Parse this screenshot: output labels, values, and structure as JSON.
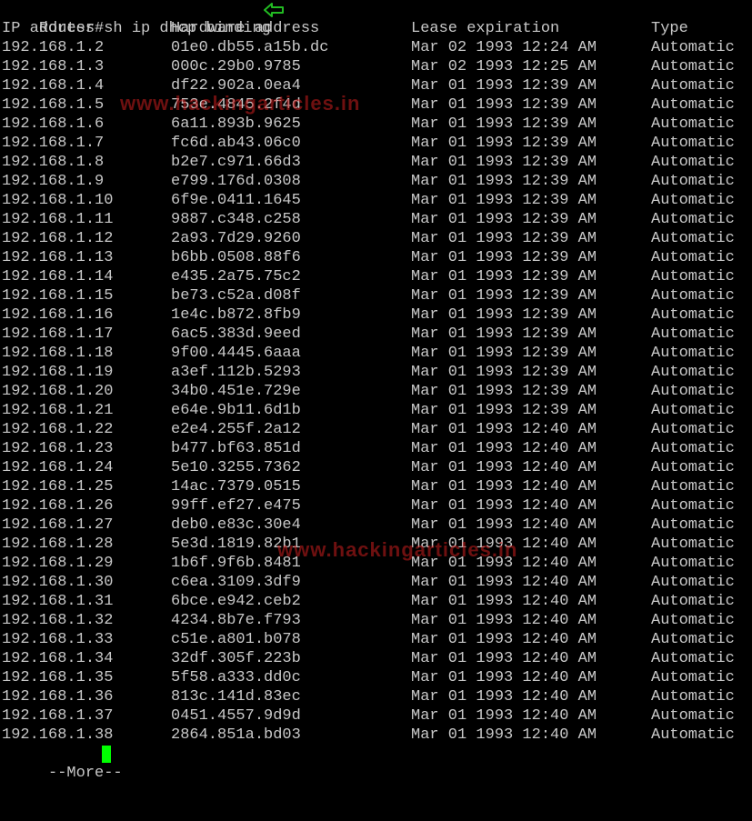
{
  "prompt": {
    "command": "Router#sh ip dhcp binding",
    "arrow_icon": "left-arrow-icon",
    "arrow_color": "#22bb22"
  },
  "headers": {
    "ip": "IP address",
    "hw": "Hardware address",
    "lease": "Lease expiration",
    "type": "Type"
  },
  "rows": [
    {
      "ip": "192.168.1.2",
      "hw": "01e0.db55.a15b.dc",
      "lease": "Mar 02 1993 12:24 AM",
      "type": "Automatic"
    },
    {
      "ip": "192.168.1.3",
      "hw": "000c.29b0.9785",
      "lease": "Mar 02 1993 12:25 AM",
      "type": "Automatic"
    },
    {
      "ip": "192.168.1.4",
      "hw": "df22.902a.0ea4",
      "lease": "Mar 01 1993 12:39 AM",
      "type": "Automatic"
    },
    {
      "ip": "192.168.1.5",
      "hw": "753e.4845.2f4d",
      "lease": "Mar 01 1993 12:39 AM",
      "type": "Automatic"
    },
    {
      "ip": "192.168.1.6",
      "hw": "6a11.893b.9625",
      "lease": "Mar 01 1993 12:39 AM",
      "type": "Automatic"
    },
    {
      "ip": "192.168.1.7",
      "hw": "fc6d.ab43.06c0",
      "lease": "Mar 01 1993 12:39 AM",
      "type": "Automatic"
    },
    {
      "ip": "192.168.1.8",
      "hw": "b2e7.c971.66d3",
      "lease": "Mar 01 1993 12:39 AM",
      "type": "Automatic"
    },
    {
      "ip": "192.168.1.9",
      "hw": "e799.176d.0308",
      "lease": "Mar 01 1993 12:39 AM",
      "type": "Automatic"
    },
    {
      "ip": "192.168.1.10",
      "hw": "6f9e.0411.1645",
      "lease": "Mar 01 1993 12:39 AM",
      "type": "Automatic"
    },
    {
      "ip": "192.168.1.11",
      "hw": "9887.c348.c258",
      "lease": "Mar 01 1993 12:39 AM",
      "type": "Automatic"
    },
    {
      "ip": "192.168.1.12",
      "hw": "2a93.7d29.9260",
      "lease": "Mar 01 1993 12:39 AM",
      "type": "Automatic"
    },
    {
      "ip": "192.168.1.13",
      "hw": "b6bb.0508.88f6",
      "lease": "Mar 01 1993 12:39 AM",
      "type": "Automatic"
    },
    {
      "ip": "192.168.1.14",
      "hw": "e435.2a75.75c2",
      "lease": "Mar 01 1993 12:39 AM",
      "type": "Automatic"
    },
    {
      "ip": "192.168.1.15",
      "hw": "be73.c52a.d08f",
      "lease": "Mar 01 1993 12:39 AM",
      "type": "Automatic"
    },
    {
      "ip": "192.168.1.16",
      "hw": "1e4c.b872.8fb9",
      "lease": "Mar 01 1993 12:39 AM",
      "type": "Automatic"
    },
    {
      "ip": "192.168.1.17",
      "hw": "6ac5.383d.9eed",
      "lease": "Mar 01 1993 12:39 AM",
      "type": "Automatic"
    },
    {
      "ip": "192.168.1.18",
      "hw": "9f00.4445.6aaa",
      "lease": "Mar 01 1993 12:39 AM",
      "type": "Automatic"
    },
    {
      "ip": "192.168.1.19",
      "hw": "a3ef.112b.5293",
      "lease": "Mar 01 1993 12:39 AM",
      "type": "Automatic"
    },
    {
      "ip": "192.168.1.20",
      "hw": "34b0.451e.729e",
      "lease": "Mar 01 1993 12:39 AM",
      "type": "Automatic"
    },
    {
      "ip": "192.168.1.21",
      "hw": "e64e.9b11.6d1b",
      "lease": "Mar 01 1993 12:39 AM",
      "type": "Automatic"
    },
    {
      "ip": "192.168.1.22",
      "hw": "e2e4.255f.2a12",
      "lease": "Mar 01 1993 12:40 AM",
      "type": "Automatic"
    },
    {
      "ip": "192.168.1.23",
      "hw": "b477.bf63.851d",
      "lease": "Mar 01 1993 12:40 AM",
      "type": "Automatic"
    },
    {
      "ip": "192.168.1.24",
      "hw": "5e10.3255.7362",
      "lease": "Mar 01 1993 12:40 AM",
      "type": "Automatic"
    },
    {
      "ip": "192.168.1.25",
      "hw": "14ac.7379.0515",
      "lease": "Mar 01 1993 12:40 AM",
      "type": "Automatic"
    },
    {
      "ip": "192.168.1.26",
      "hw": "99ff.ef27.e475",
      "lease": "Mar 01 1993 12:40 AM",
      "type": "Automatic"
    },
    {
      "ip": "192.168.1.27",
      "hw": "deb0.e83c.30e4",
      "lease": "Mar 01 1993 12:40 AM",
      "type": "Automatic"
    },
    {
      "ip": "192.168.1.28",
      "hw": "5e3d.1819.82b1",
      "lease": "Mar 01 1993 12:40 AM",
      "type": "Automatic"
    },
    {
      "ip": "192.168.1.29",
      "hw": "1b6f.9f6b.8481",
      "lease": "Mar 01 1993 12:40 AM",
      "type": "Automatic"
    },
    {
      "ip": "192.168.1.30",
      "hw": "c6ea.3109.3df9",
      "lease": "Mar 01 1993 12:40 AM",
      "type": "Automatic"
    },
    {
      "ip": "192.168.1.31",
      "hw": "6bce.e942.ceb2",
      "lease": "Mar 01 1993 12:40 AM",
      "type": "Automatic"
    },
    {
      "ip": "192.168.1.32",
      "hw": "4234.8b7e.f793",
      "lease": "Mar 01 1993 12:40 AM",
      "type": "Automatic"
    },
    {
      "ip": "192.168.1.33",
      "hw": "c51e.a801.b078",
      "lease": "Mar 01 1993 12:40 AM",
      "type": "Automatic"
    },
    {
      "ip": "192.168.1.34",
      "hw": "32df.305f.223b",
      "lease": "Mar 01 1993 12:40 AM",
      "type": "Automatic"
    },
    {
      "ip": "192.168.1.35",
      "hw": "5f58.a333.dd0c",
      "lease": "Mar 01 1993 12:40 AM",
      "type": "Automatic"
    },
    {
      "ip": "192.168.1.36",
      "hw": "813c.141d.83ec",
      "lease": "Mar 01 1993 12:40 AM",
      "type": "Automatic"
    },
    {
      "ip": "192.168.1.37",
      "hw": "0451.4557.9d9d",
      "lease": "Mar 01 1993 12:40 AM",
      "type": "Automatic"
    },
    {
      "ip": "192.168.1.38",
      "hw": "2864.851a.bd03",
      "lease": "Mar 01 1993 12:40 AM",
      "type": "Automatic"
    }
  ],
  "pager": {
    "text": " --More-- ",
    "cursor_color": "#00ff00"
  },
  "watermark": {
    "text": "www.hackingarticles.in"
  }
}
